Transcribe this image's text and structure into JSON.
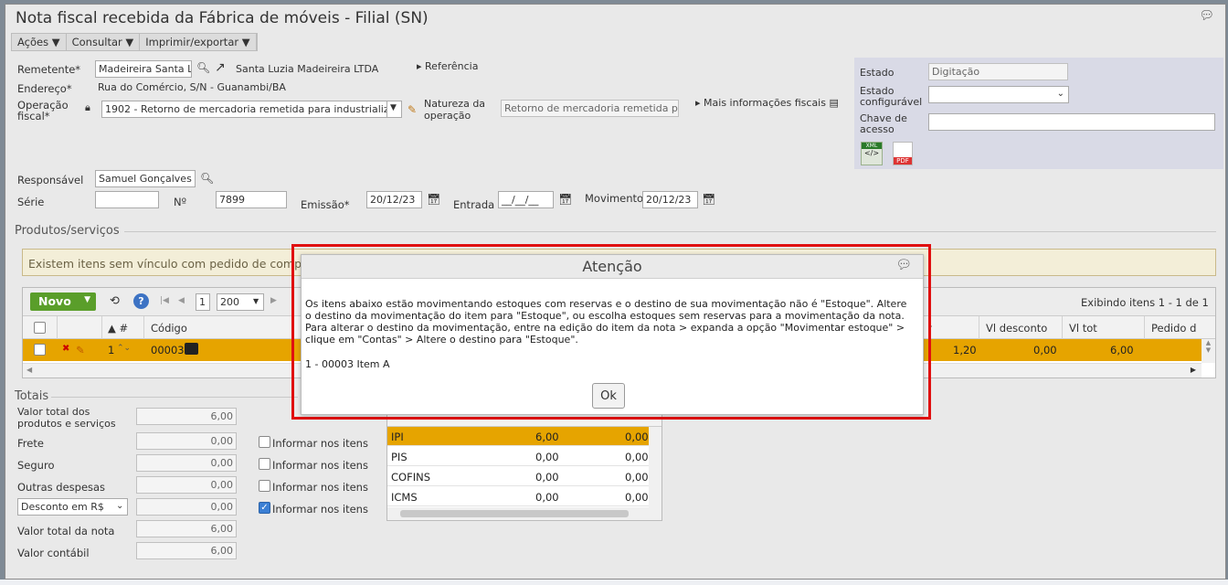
{
  "window": {
    "title": "Nota fiscal recebida da Fábrica de móveis - Filial (SN)"
  },
  "menu": [
    "Ações",
    "Consultar",
    "Imprimir/exportar"
  ],
  "form": {
    "remetente_label": "Remetente*",
    "remetente_value": "Madeireira Santa L",
    "remetente_nome": "Santa Luzia Madeireira LTDA",
    "referencia": "Referência",
    "endereco_label": "Endereço*",
    "endereco_value": "Rua do Comércio, S/N - Guanambi/BA",
    "operacao_label_1": "Operação",
    "operacao_label_2": "fiscal*",
    "operacao_value": "1902 - Retorno de mercadoria remetida para industrializa",
    "natureza_label_1": "Natureza da",
    "natureza_label_2": "operação",
    "natureza_value": "Retorno de mercadoria remetida pa",
    "mais_info": "Mais informações fiscais",
    "responsavel_label": "Responsável",
    "responsavel_value": "Samuel Gonçalves",
    "serie_label": "Série",
    "numero_label": "Nº",
    "numero_value": "7899",
    "emissao_label": "Emissão*",
    "emissao_value": "20/12/23",
    "entrada_label": "Entrada",
    "entrada_value": "__/__/__",
    "movimento_label": "Movimento",
    "movimento_value": "20/12/23"
  },
  "status_panel": {
    "estado_label": "Estado",
    "estado_value": "Digitação",
    "estado_config_label_1": "Estado",
    "estado_config_label_2": "configurável",
    "chave_label_1": "Chave de",
    "chave_label_2": "acesso",
    "xml_label": "XML",
    "pdf_label": "PDF"
  },
  "produtos": {
    "section_title": "Produtos/serviços",
    "warning": "Existem itens sem vínculo com pedido de comp",
    "novo_label": "Novo",
    "page_value": "1",
    "page_size": "200",
    "exibindo": "Exibindo itens 1 - 1 de 1",
    "columns": [
      "#",
      "Código",
      "r",
      "Vl desconto",
      "Vl tot",
      "Pedido d"
    ],
    "row": {
      "num": "1",
      "codigo": "00003",
      "valor": "1,20",
      "desconto": "0,00",
      "total": "6,00"
    }
  },
  "totais": {
    "section_title": "Totais",
    "rows": [
      {
        "label": "Valor total dos produtos e serviços",
        "value": "6,00"
      },
      {
        "label": "Frete",
        "value": "0,00",
        "check_label": "Informar nos itens",
        "checked": false
      },
      {
        "label": "Seguro",
        "value": "0,00",
        "check_label": "Informar nos itens",
        "checked": false
      },
      {
        "label": "Outras despesas",
        "value": "0,00",
        "check_label": "Informar nos itens",
        "checked": false
      },
      {
        "label": "Desconto em R$",
        "value": "0,00",
        "check_label": "Informar nos itens",
        "checked": true
      },
      {
        "label": "Valor total da nota",
        "value": "6,00"
      },
      {
        "label": "Valor contábil",
        "value": "6,00"
      }
    ],
    "taxes": [
      {
        "name": "IPI",
        "v1": "6,00",
        "v2": "0,00"
      },
      {
        "name": "PIS",
        "v1": "0,00",
        "v2": "0,00"
      },
      {
        "name": "COFINS",
        "v1": "0,00",
        "v2": "0,00"
      },
      {
        "name": "ICMS",
        "v1": "0,00",
        "v2": "0,00"
      }
    ]
  },
  "dialog": {
    "title": "Atenção",
    "message": "Os itens abaixo estão movimentando estoques com reservas e o destino de sua movimentação não é \"Estoque\". Altere o destino da movimentação do item para \"Estoque\", ou escolha estoques sem reservas para a movimentação da nota. Para alterar o destino da movimentação, entre na edição do item da nota > expanda a opção \"Movimentar estoque\" > clique em \"Contas\" > Altere o destino para \"Estoque\".",
    "item": "1 - 00003 Item A",
    "ok_label": "Ok"
  },
  "colors": {
    "accent_row": "#e6a400",
    "novo_button": "#5a9e2a",
    "highlight_border": "#e01010"
  }
}
